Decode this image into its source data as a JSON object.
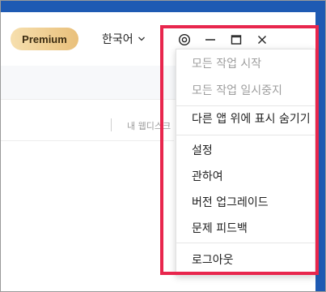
{
  "header": {
    "premium_label": "Premium",
    "language_label": "한국어"
  },
  "window_controls": {
    "target_icon": "target-icon",
    "minimize_icon": "minimize-icon",
    "maximize_icon": "maximize-icon",
    "close_icon": "close-icon"
  },
  "content": {
    "web_label": "내 웹디스크"
  },
  "menu": {
    "items": [
      {
        "label": "모든 작업 시작",
        "disabled": true
      },
      {
        "label": "모든 작업 일시중지",
        "disabled": true
      },
      {
        "label": "다른 앱 위에 표시 숨기기",
        "disabled": false
      },
      {
        "label": "설정",
        "disabled": false
      },
      {
        "label": "관하여",
        "disabled": false
      },
      {
        "label": "버전 업그레이드",
        "disabled": false
      },
      {
        "label": "문제 피드백",
        "disabled": false
      },
      {
        "label": "로그아웃",
        "disabled": false
      }
    ]
  },
  "colors": {
    "highlight": "#e8264d",
    "desktop": "#1e5ab3",
    "premium_gradient_start": "#f6dfae",
    "premium_gradient_end": "#e9c07b"
  }
}
